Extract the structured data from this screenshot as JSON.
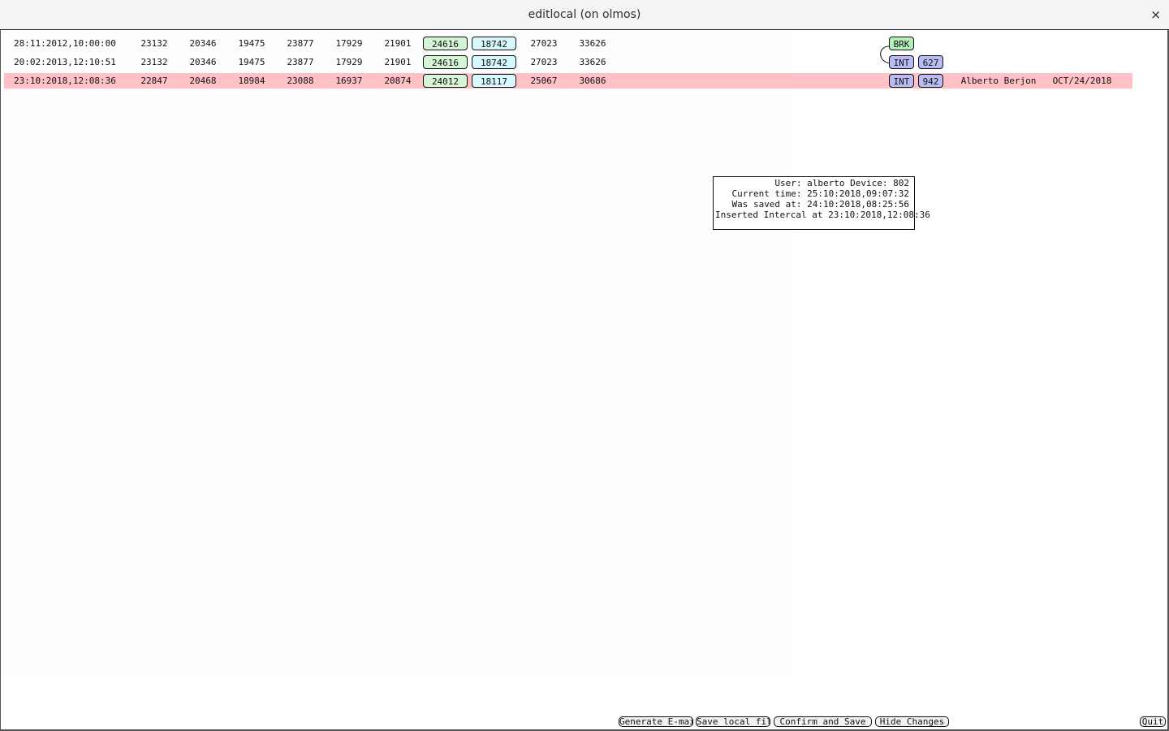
{
  "window": {
    "title": "editlocal (on olmos)",
    "close_label": "×"
  },
  "rows": [
    {
      "date": "28:11:2012,10:00:00",
      "values": [
        "23132",
        "20346",
        "19475",
        "23877",
        "17929",
        "21901"
      ],
      "box_green": "24616",
      "box_cyan": "18742",
      "tail": [
        "27023",
        "33626"
      ],
      "tag": "BRK",
      "highlight": false
    },
    {
      "date": "20:02:2013,12:10:51",
      "values": [
        "23132",
        "20346",
        "19475",
        "23877",
        "17929",
        "21901"
      ],
      "box_green": "24616",
      "box_cyan": "18742",
      "tail": [
        "27023",
        "33626"
      ],
      "tag": "INT",
      "tag_num": "627",
      "highlight": false
    },
    {
      "date": "23:10:2018,12:08:36",
      "values": [
        "22847",
        "20468",
        "18984",
        "23088",
        "16937",
        "20874"
      ],
      "box_green": "24012",
      "box_cyan": "18117",
      "tail": [
        "25067",
        "30686"
      ],
      "tag": "INT",
      "tag_num": "942",
      "user_name": "Alberto Berjon",
      "change_date": "OCT/24/2018",
      "highlight": true
    }
  ],
  "info_panel": {
    "line1": "User: alberto Device: 802",
    "line2": "Current time: 25:10:2018,09:07:32",
    "line3": "Was saved at: 24:10:2018,08:25:56",
    "line4": "Inserted Intercal at 23:10:2018,12:08:36"
  },
  "buttons": {
    "generate_email": "Generate E-mail",
    "save_local": "Save local file",
    "confirm_save": "Confirm and Save",
    "hide_changes": "Hide Changes",
    "quit": "Quit"
  },
  "colors": {
    "highlight_row": "#ffc0c6",
    "box_green": "#d6f5d6",
    "box_cyan": "#d6f7fb",
    "tag_int": "#b9bcf2",
    "tag_brk": "#b6f0b6"
  }
}
